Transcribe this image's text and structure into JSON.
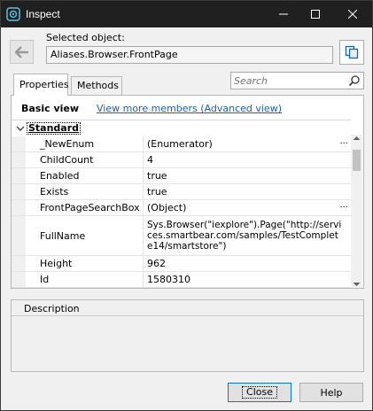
{
  "window": {
    "title": "Inspect"
  },
  "titlebar_icons": [
    "inspect-app-icon",
    "minimize-icon",
    "maximize-icon",
    "close-icon"
  ],
  "selected": {
    "label": "Selected object:",
    "value": "Aliases.Browser.FrontPage"
  },
  "tabs": [
    {
      "label": "Properties",
      "active": true
    },
    {
      "label": "Methods",
      "active": false
    }
  ],
  "search": {
    "placeholder": "Search"
  },
  "view": {
    "basic_label": "Basic view",
    "advanced_link": "View more members (Advanced view)"
  },
  "category": {
    "label": "Standard"
  },
  "properties": [
    {
      "name": "_NewEnum",
      "value": "(Enumerator)",
      "has_ellipsis": true
    },
    {
      "name": "ChildCount",
      "value": "4",
      "has_ellipsis": false
    },
    {
      "name": "Enabled",
      "value": "true",
      "has_ellipsis": false
    },
    {
      "name": "Exists",
      "value": "true",
      "has_ellipsis": false
    },
    {
      "name": "FrontPageSearchBox",
      "value": "(Object)",
      "has_ellipsis": true
    },
    {
      "name": "FullName",
      "value": "Sys.Browser(\"iexplore\").Page(\"http://services.smartbear.com/samples/TestComplete14/smartstore\")",
      "has_ellipsis": false
    },
    {
      "name": "Height",
      "value": "962",
      "has_ellipsis": false
    },
    {
      "name": "Id",
      "value": "1580310",
      "has_ellipsis": false
    }
  ],
  "ellipsis_glyph": "···",
  "description": {
    "header": "Description"
  },
  "buttons": {
    "close": "Close",
    "help": "Help"
  },
  "colors": {
    "titlebar": "#202020",
    "link": "#1a5fb4",
    "accent": "#0078d7"
  }
}
